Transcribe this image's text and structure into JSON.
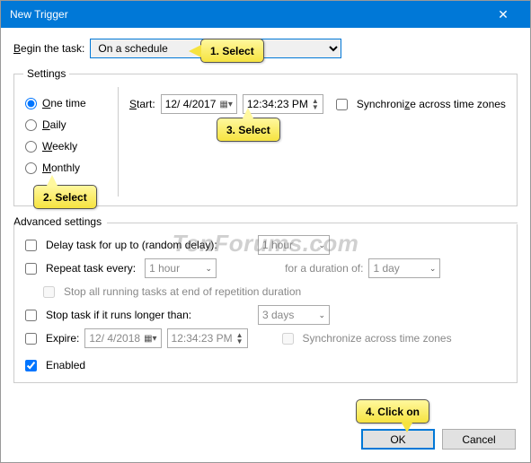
{
  "window": {
    "title": "New Trigger",
    "close": "✕"
  },
  "begin": {
    "label": "Begin the task:",
    "value": "On a schedule"
  },
  "settings": {
    "legend": "Settings",
    "radios": [
      {
        "label": "One time",
        "ul": "O",
        "rest": "ne time",
        "checked": true
      },
      {
        "label": "Daily",
        "ul": "D",
        "rest": "aily",
        "checked": false
      },
      {
        "label": "Weekly",
        "ul": "W",
        "rest": "eekly",
        "checked": false
      },
      {
        "label": "Monthly",
        "ul": "M",
        "rest": "onthly",
        "checked": false
      }
    ],
    "start_label": "Start:",
    "start_ul": "S",
    "start_rest": "tart:",
    "date": "12/ 4/2017",
    "time": "12:34:23 PM",
    "sync_label": "Synchronize across time zones",
    "sync_ul": "z",
    "sync_pre": "Synchroni",
    "sync_post": "e across time zones"
  },
  "advanced": {
    "legend": "Advanced settings",
    "delay_label": "Delay task for up to (random delay):",
    "delay_value": "1 hour",
    "repeat_label": "Repeat task every:",
    "repeat_value": "1 hour",
    "duration_label": "for a duration of:",
    "duration_value": "1 day",
    "stopall_label": "Stop all running tasks at end of repetition duration",
    "stoplong_label": "Stop task if it runs longer than:",
    "stoplong_value": "3 days",
    "expire_label": "Expire:",
    "expire_date": "12/ 4/2018",
    "expire_time": "12:34:23 PM",
    "expire_sync": "Synchronize across time zones",
    "enabled_label": "Enabled"
  },
  "buttons": {
    "ok": "OK",
    "cancel": "Cancel"
  },
  "watermark": "TenForums.com",
  "callouts": {
    "c1": "1. Select",
    "c2": "2. Select",
    "c3": "3. Select",
    "c4": "4. Click on"
  }
}
